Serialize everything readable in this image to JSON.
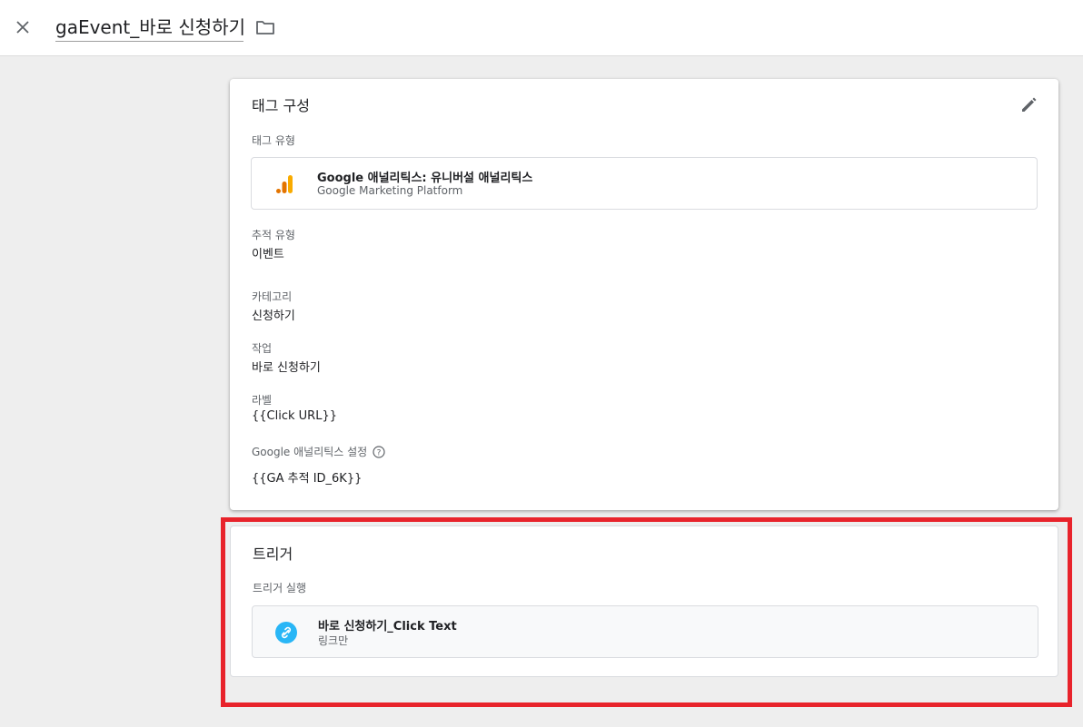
{
  "header": {
    "title": "gaEvent_바로 신청하기",
    "close_icon": "close-icon",
    "folder_icon": "folder-icon"
  },
  "config_card": {
    "title": "태그 구성",
    "tag_type_label": "태그 유형",
    "tag_type": {
      "name": "Google 애널리틱스: 유니버설 애널리틱스",
      "vendor": "Google Marketing Platform",
      "icon": "google-analytics-icon"
    },
    "tracking_type_label": "추적 유형",
    "tracking_type": "이벤트",
    "category_label": "카테고리",
    "category": "신청하기",
    "action_label": "작업",
    "action": "바로 신청하기",
    "label_label": "라벨",
    "label": "{{Click URL}}",
    "ga_settings_label": "Google 애널리틱스 설정",
    "ga_settings": "{{GA 추적 ID_6K}}"
  },
  "trigger_card": {
    "title": "트리거",
    "firing_label": "트리거 실행",
    "trigger": {
      "name": "바로 신청하기_Click Text",
      "type": "링크만",
      "icon": "link-icon"
    }
  },
  "colors": {
    "highlight": "#e8232b",
    "ga_orange": "#f9ab00",
    "ga_dark_orange": "#e37400",
    "link_blue": "#29b6f6"
  }
}
